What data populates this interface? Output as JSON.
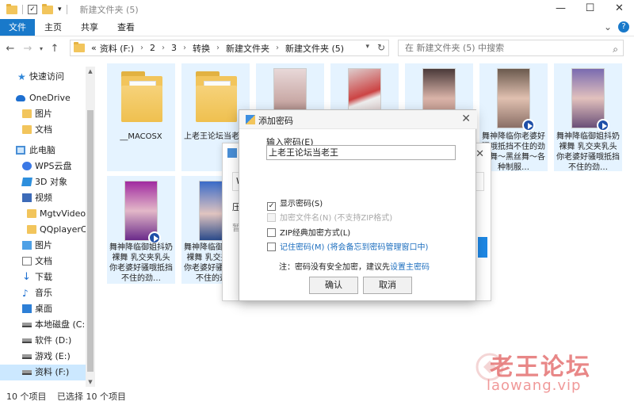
{
  "window": {
    "title": "新建文件夹 (5)",
    "controls": [
      "—",
      "☐",
      "✕"
    ]
  },
  "ribbon": {
    "tabs": [
      "文件",
      "主页",
      "共享",
      "查看"
    ],
    "chevron": "⌄",
    "help": "?"
  },
  "address": {
    "prefix": "«",
    "crumbs": [
      "资料 (F:)",
      "2",
      "3",
      "转换",
      "新建文件夹",
      "新建文件夹 (5)"
    ],
    "search_placeholder": "在 新建文件夹 (5) 中搜索"
  },
  "sidebar": {
    "items": [
      {
        "label": "快速访问",
        "icon": "star-icon"
      },
      {
        "label": "OneDrive",
        "icon": "cloud-icon"
      },
      {
        "label": "图片",
        "icon": "folder-icon"
      },
      {
        "label": "文档",
        "icon": "folder-icon"
      },
      {
        "label": "此电脑",
        "icon": "pc-icon"
      },
      {
        "label": "WPS云盘",
        "icon": "wps-icon"
      },
      {
        "label": "3D 对象",
        "icon": "cube-icon"
      },
      {
        "label": "视频",
        "icon": "video-icon"
      },
      {
        "label": "MgtvVideos",
        "icon": "folder-icon"
      },
      {
        "label": "QQplayerCl",
        "icon": "folder-icon"
      },
      {
        "label": "图片",
        "icon": "pictures-icon"
      },
      {
        "label": "文档",
        "icon": "documents-icon"
      },
      {
        "label": "下载",
        "icon": "download-icon"
      },
      {
        "label": "音乐",
        "icon": "music-icon"
      },
      {
        "label": "桌面",
        "icon": "desktop-icon"
      },
      {
        "label": "本地磁盘 (C:)",
        "icon": "drive-icon"
      },
      {
        "label": "软件 (D:)",
        "icon": "drive-icon"
      },
      {
        "label": "游戏 (E:)",
        "icon": "drive-icon"
      },
      {
        "label": "资料 (F:)",
        "icon": "drive-icon"
      }
    ]
  },
  "files": [
    {
      "label": "__MACOSX",
      "kind": "folder"
    },
    {
      "label": "上老王论坛当老王",
      "kind": "folder"
    },
    {
      "label": "",
      "kind": "image"
    },
    {
      "label": "",
      "kind": "image"
    },
    {
      "label": "",
      "kind": "image"
    },
    {
      "label": "舞神降临你老婆好骚哦抵挡不住的劲爆舞～黑丝舞～各种制服…",
      "kind": "video"
    },
    {
      "label": "舞神降临御姐抖奶裸舞 乳交夹乳头你老婆好骚哦抵挡不住的劲…",
      "kind": "video"
    },
    {
      "label": "舞神降临御姐抖奶裸舞 乳交夹乳头你老婆好骚哦抵挡不住的劲…",
      "kind": "video"
    },
    {
      "label": "舞神降临御姐抖奶裸舞 乳交夹乳头你老婆好骚哦抵挡不住的劲…",
      "kind": "video"
    }
  ],
  "status": {
    "count": "10 个项目",
    "selected": "已选择 10 个项目"
  },
  "bg_dialog": {
    "field_char": "W",
    "text1": "压",
    "text2": "暂"
  },
  "dialog": {
    "title": "添加密码",
    "password_label": "输入密码(E)",
    "password_value": "上老王论坛当老王",
    "options": [
      {
        "label": "显示密码(S)",
        "checked": true,
        "disabled": false
      },
      {
        "label": "加密文件名(N) (不支持ZIP格式)",
        "checked": false,
        "disabled": true
      },
      {
        "label": "ZIP经典加密方式(L)",
        "checked": false,
        "disabled": false
      },
      {
        "label": "记住密码(M) (将会备忘到密码管理窗口中)",
        "checked": false,
        "disabled": false
      }
    ],
    "note_prefix": "注：密码没有安全加密，建议先",
    "note_link": "设置主密码",
    "ok": "确认",
    "cancel": "取消"
  },
  "watermark": {
    "text": "老王论坛",
    "url": "laowang.vip"
  }
}
